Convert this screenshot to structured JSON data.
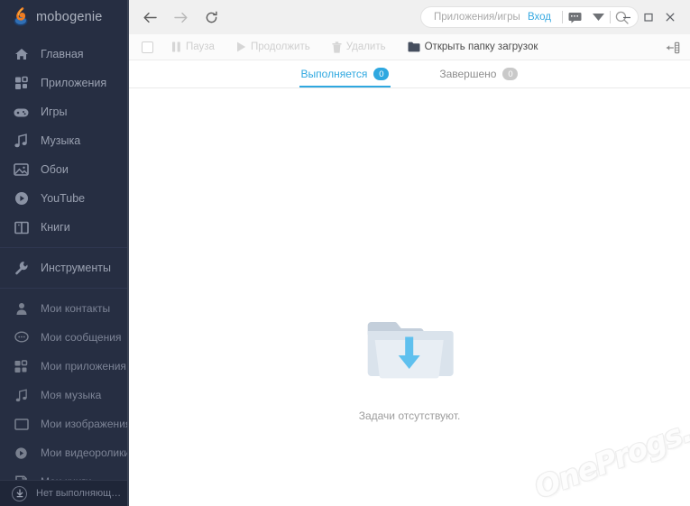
{
  "app": {
    "brand": "mobogenie",
    "logo_colors": {
      "orange": "#f07d22",
      "blue": "#2a7fc9"
    }
  },
  "sidebar": {
    "primary_items": [
      {
        "label": "Главная",
        "icon": "home-icon"
      },
      {
        "label": "Приложения",
        "icon": "apps-grid-icon"
      },
      {
        "label": "Игры",
        "icon": "gamepad-icon"
      },
      {
        "label": "Музыка",
        "icon": "music-note-icon"
      },
      {
        "label": "Обои",
        "icon": "wallpaper-icon"
      },
      {
        "label": "YouTube",
        "icon": "play-circle-icon"
      },
      {
        "label": "Книги",
        "icon": "book-icon"
      }
    ],
    "tools_item": {
      "label": "Инструменты",
      "icon": "wrench-icon"
    },
    "my_items": [
      {
        "label": "Мои контакты",
        "icon": "contact-person-icon"
      },
      {
        "label": "Мои сообщения",
        "icon": "message-bubble-icon"
      },
      {
        "label": "Мои приложения",
        "icon": "apps-grid-icon"
      },
      {
        "label": "Моя музыка",
        "icon": "music-note-icon"
      },
      {
        "label": "Мои изображения",
        "icon": "image-icon"
      },
      {
        "label": "Мои видеоролики",
        "icon": "video-circle-icon"
      },
      {
        "label": "Мои книги",
        "icon": "book-page-icon"
      }
    ],
    "download_status": {
      "label": "Нет выполняющ…",
      "icon": "download-circle-icon"
    }
  },
  "topbar": {
    "back_icon": "arrow-left-icon",
    "forward_icon": "arrow-right-icon",
    "refresh_icon": "refresh-icon",
    "search": {
      "placeholder": "Приложения/игры",
      "value": "",
      "icon": "search-icon"
    },
    "login_label": "Вход",
    "message_icon": "chat-icon",
    "dropdown_icon": "caret-down-icon",
    "minimize_icon": "minimize-icon",
    "maximize_icon": "maximize-icon",
    "close_icon": "close-icon"
  },
  "toolbar": {
    "select_all_checked": false,
    "buttons": [
      {
        "label": "Пауза",
        "icon": "pause-icon",
        "enabled": false
      },
      {
        "label": "Продолжить",
        "icon": "play-icon",
        "enabled": false
      },
      {
        "label": "Удалить",
        "icon": "trash-icon",
        "enabled": false
      },
      {
        "label": "Открыть папку загрузок",
        "icon": "folder-icon",
        "enabled": true
      }
    ],
    "collapse_icon": "collapse-panel-icon"
  },
  "tabs": [
    {
      "label": "Выполняется",
      "count": "0",
      "active": true
    },
    {
      "label": "Завершено",
      "count": "0",
      "active": false
    }
  ],
  "empty_state": {
    "icon": "folder-download-icon",
    "message": "Задачи отсутствуют."
  },
  "watermark": {
    "text": "OneProgs.ru"
  },
  "colors": {
    "sidebar_bg": "#262e42",
    "accent": "#2fa8e0",
    "link": "#35a8e0",
    "topbar_bg": "#f0f0f0"
  }
}
